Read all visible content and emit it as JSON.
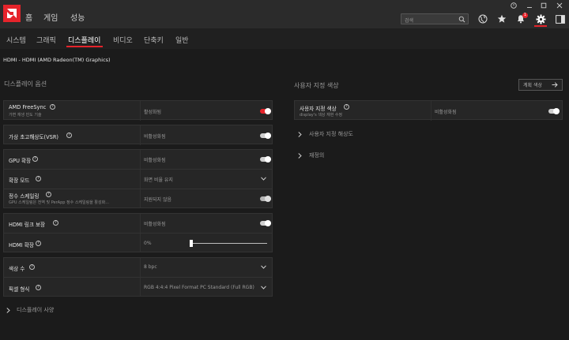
{
  "top_nav": {
    "home": "홈",
    "gaming": "게임",
    "performance": "성능"
  },
  "search": {
    "placeholder": "검색"
  },
  "notifications": {
    "count": "1"
  },
  "sub_nav": {
    "items": [
      "시스템",
      "그래픽",
      "디스플레이",
      "비디오",
      "단축키",
      "일반"
    ],
    "active": "디스플레이"
  },
  "device": {
    "title": "HDMI - HDMI (AMD Radeon(TM) Graphics)"
  },
  "display_options": {
    "title": "디스플레이 옵션",
    "freesync": {
      "label": "AMD FreeSync",
      "sub": "가변 재생 빈도 기술",
      "value": "활성화됨",
      "enabled": true
    },
    "vsr": {
      "label": "가상 초고해상도(VSR)",
      "value": "비활성화됨",
      "enabled": false
    },
    "gpu_scaling": {
      "label": "GPU 확장",
      "value": "비활성화됨",
      "enabled": false
    },
    "scaling_mode": {
      "label": "확장 모드",
      "value": "화면 비율 유지"
    },
    "integer_scaling": {
      "label": "정수 스케일링",
      "sub": "GPU 스케일링은 전역 및 PerApp 정수 스케일링을 활성화...",
      "value": "지원되지 않음",
      "enabled": false
    },
    "hdmi_link": {
      "label": "HDMI 링크 보장",
      "value": "비활성화됨",
      "enabled": false
    },
    "hdmi_scaling": {
      "label": "HDMI 확장",
      "value": "0%",
      "level": 0
    },
    "color_depth": {
      "label": "색상 수",
      "value": "8 bpc"
    },
    "pixel_format": {
      "label": "픽셀 형식",
      "value": "RGB 4:4:4 Pixel Format PC Standard (Full RGB)"
    },
    "specs": {
      "label": "디스플레이 사양"
    }
  },
  "custom_color": {
    "title": "사용자 지정 색상",
    "button": "계획 색상",
    "custom_color_row": {
      "label": "사용자 지정 색상",
      "sub": "display's 색상 재현 수정",
      "value": "비활성화됨",
      "enabled": false
    },
    "custom_resolution": {
      "label": "사용자 지정 해상도"
    },
    "overrides": {
      "label": "재정의"
    }
  },
  "colors": {
    "accent": "#e5242b",
    "bg": "#1b1b1b",
    "panel": "#262626"
  }
}
